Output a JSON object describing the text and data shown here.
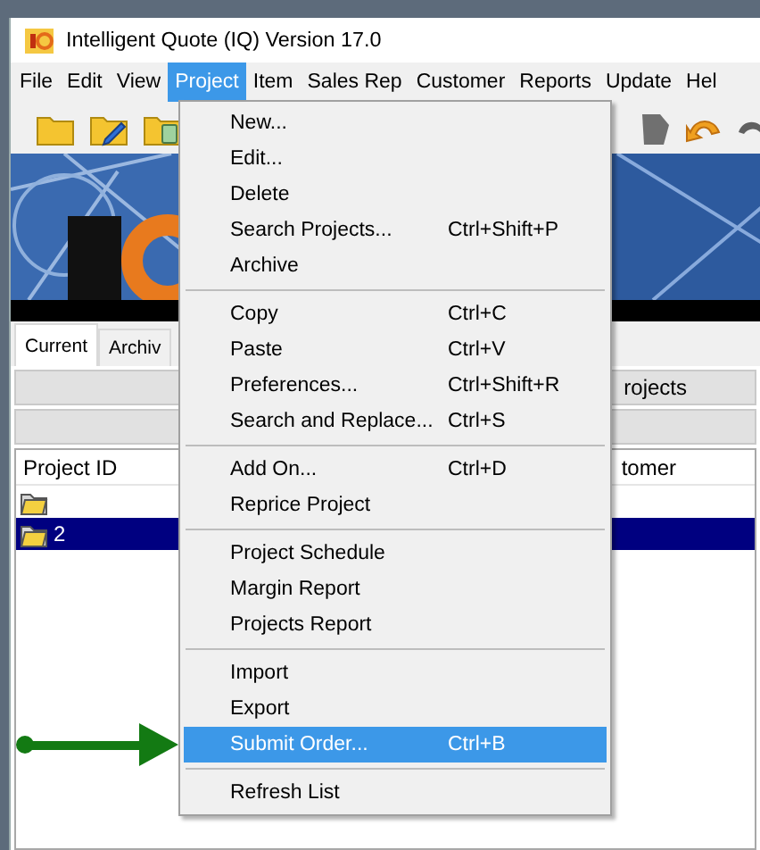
{
  "window": {
    "title": "Intelligent Quote (IQ) Version 17.0"
  },
  "menu_bar": [
    {
      "label": "File",
      "selected": false
    },
    {
      "label": "Edit",
      "selected": false
    },
    {
      "label": "View",
      "selected": false
    },
    {
      "label": "Project",
      "selected": true
    },
    {
      "label": "Item",
      "selected": false
    },
    {
      "label": "Sales Rep",
      "selected": false
    },
    {
      "label": "Customer",
      "selected": false
    },
    {
      "label": "Reports",
      "selected": false
    },
    {
      "label": "Update",
      "selected": false
    },
    {
      "label": "Hel",
      "selected": false
    }
  ],
  "project_menu": {
    "sections": [
      [
        {
          "label": "New...",
          "selected": false
        },
        {
          "label": "Edit...",
          "selected": false
        },
        {
          "label": "Delete",
          "selected": false
        },
        {
          "label": "Search Projects...",
          "shortcut": "Ctrl+Shift+P",
          "selected": false
        },
        {
          "label": "Archive",
          "selected": false
        }
      ],
      [
        {
          "label": "Copy",
          "shortcut": "Ctrl+C",
          "selected": false
        },
        {
          "label": "Paste",
          "shortcut": "Ctrl+V",
          "selected": false
        },
        {
          "label": "Preferences...",
          "shortcut": "Ctrl+Shift+R",
          "selected": false
        },
        {
          "label": "Search and Replace...",
          "shortcut": "Ctrl+S",
          "selected": false
        }
      ],
      [
        {
          "label": "Add On...",
          "shortcut": "Ctrl+D",
          "selected": false
        },
        {
          "label": "Reprice Project",
          "selected": false
        }
      ],
      [
        {
          "label": "Project Schedule",
          "selected": false
        },
        {
          "label": "Margin Report",
          "selected": false
        },
        {
          "label": "Projects Report",
          "selected": false
        }
      ],
      [
        {
          "label": "Import",
          "selected": false
        },
        {
          "label": "Export",
          "selected": false
        },
        {
          "label": "Submit Order...",
          "shortcut": "Ctrl+B",
          "selected": true
        }
      ],
      [
        {
          "label": "Refresh List",
          "selected": false
        }
      ]
    ]
  },
  "tabs": [
    {
      "label": "Current",
      "selected": true
    },
    {
      "label": "Archiv",
      "selected": false
    }
  ],
  "filter_bar": {
    "label": "rojects"
  },
  "project_list": {
    "columns": [
      "Project ID",
      "tomer"
    ],
    "rows": [
      {
        "selected": false
      },
      {
        "label": "2",
        "selected": true
      }
    ]
  }
}
